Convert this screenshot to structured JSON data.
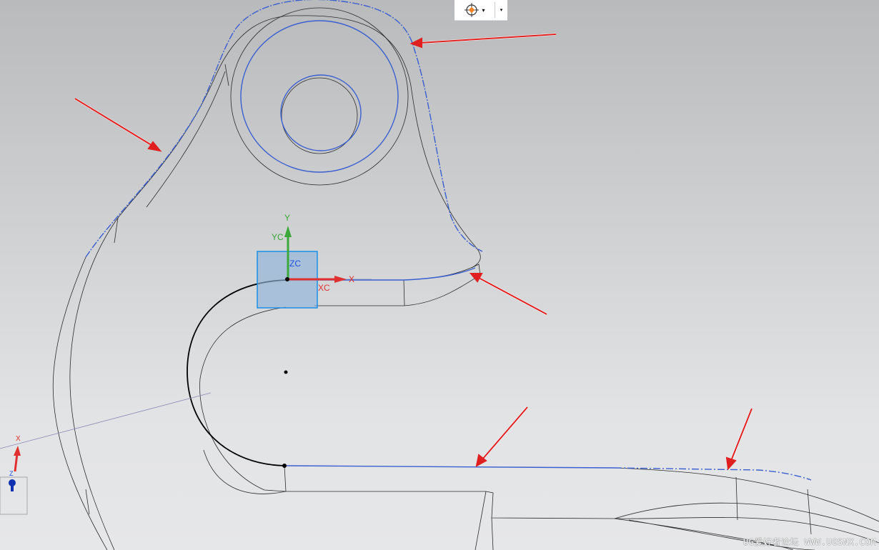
{
  "toolbar": {
    "snap_icon": "snap-point-icon",
    "dropdown_glyph": "▾",
    "overflow_glyph": "▾"
  },
  "csys": {
    "y_label": "Y",
    "yc_label": "YC",
    "zc_label": "ZC",
    "x_label": "X",
    "xc_label": "XC"
  },
  "triad": {
    "x_label": "X",
    "z_label": "Z"
  },
  "watermark": "UG爱好者论坛 WWW.UGSNX.COM",
  "colors": {
    "edge": "#2b2b2b",
    "highlight": "#3a5fcf",
    "arrow": "#e02020",
    "csys_box": "#8fb3d9"
  }
}
